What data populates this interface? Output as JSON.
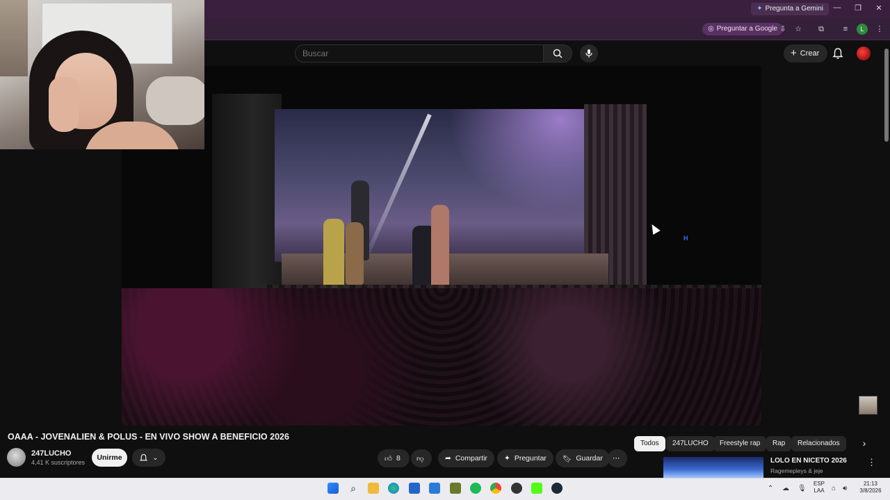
{
  "browser": {
    "gemini_button": "Pregunta a Gemini",
    "google_button": "Preguntar a Google",
    "profile_initial": "L",
    "accent_color": "#3a1f3e"
  },
  "youtube": {
    "search_placeholder": "Buscar",
    "create_label": "Crear"
  },
  "video": {
    "title": "OAAA - JOVENALIEN & POLUS - EN VIVO SHOW A BENEFICIO 2026",
    "channel_name": "247LUCHO",
    "subscribers": "4,41 K suscriptores",
    "join_label": "Unirme",
    "like_count": "8",
    "share_label": "Compartir",
    "ask_label": "Preguntar",
    "save_label": "Guardar"
  },
  "chips": [
    "Todos",
    "247LUCHO",
    "Freestyle rap",
    "Rap",
    "Relacionados"
  ],
  "related": {
    "title": "LOLO EN NICETO 2026",
    "channel": "Ragemepleys & jeje"
  },
  "player_sign": "H",
  "taskbar": {
    "lang_top": "ESP",
    "lang_bottom": "LAA",
    "time": "21:13",
    "date": "3/8/2026"
  }
}
